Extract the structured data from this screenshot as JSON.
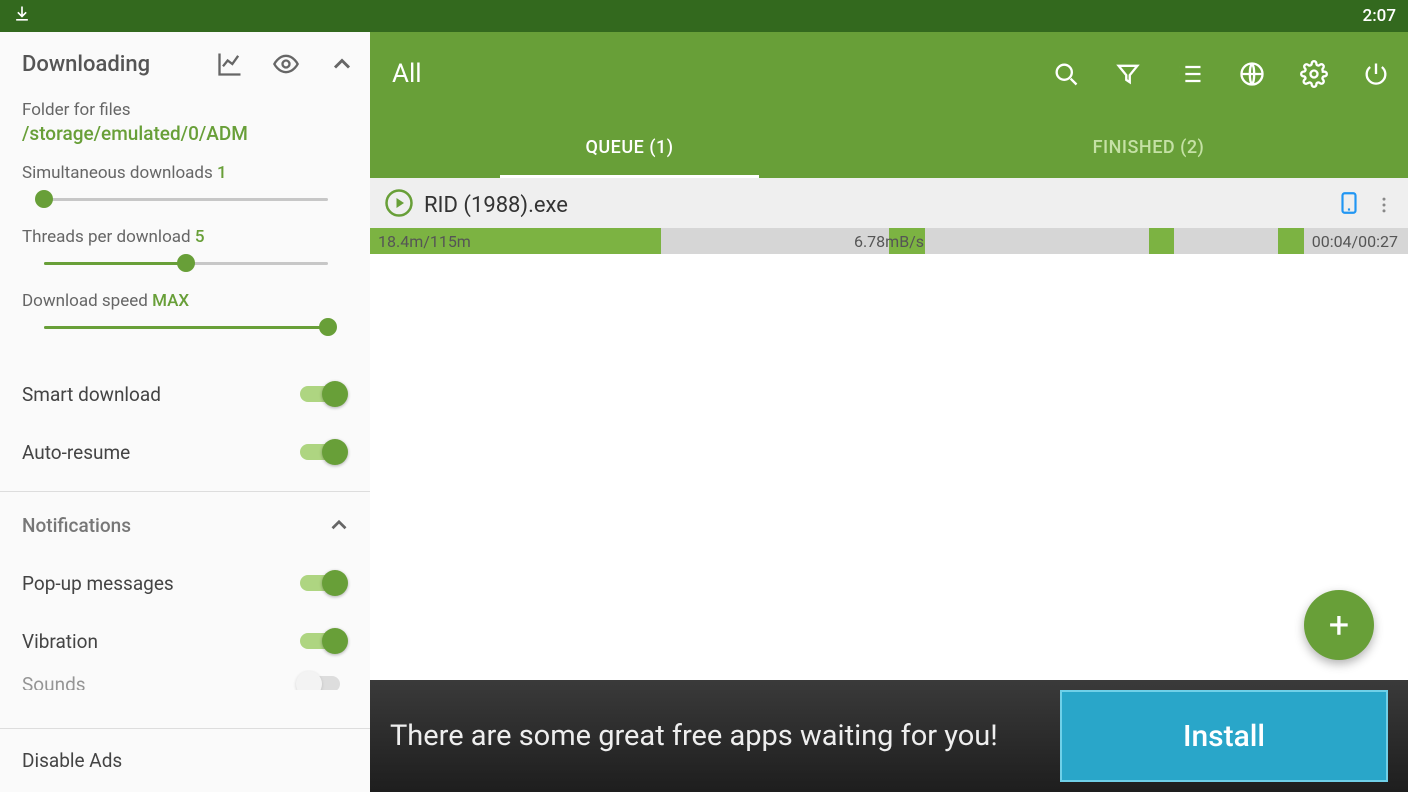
{
  "status": {
    "time": "2:07"
  },
  "sidebar": {
    "downloading_title": "Downloading",
    "folder_label": "Folder for files",
    "folder_path": "/storage/emulated/0/ADM",
    "simul_label": "Simultaneous downloads ",
    "simul_val": "1",
    "threads_label": "Threads per download ",
    "threads_val": "5",
    "speed_label": "Download speed ",
    "speed_val": "MAX",
    "smart_download": "Smart download",
    "auto_resume": "Auto-resume",
    "notifications_title": "Notifications",
    "popup": "Pop-up messages",
    "vibration": "Vibration",
    "sounds": "Sounds",
    "disable_ads": "Disable Ads"
  },
  "main": {
    "title": "All",
    "tab_queue": "QUEUE (1)",
    "tab_finished": "FINISHED (2)"
  },
  "download": {
    "filename": "RID (1988).exe",
    "size": "18.4m/115m",
    "speed": "6.78mB/s",
    "time": "00:04/00:27"
  },
  "ad": {
    "text": "There are some great free apps waiting for you!",
    "button": "Install"
  }
}
